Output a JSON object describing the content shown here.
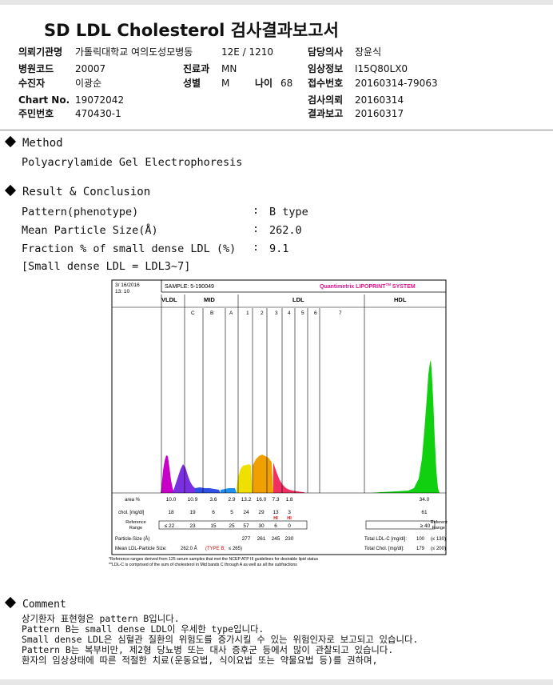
{
  "title": "SD LDL Cholesterol 검사결과보고서",
  "header": {
    "institution_label": "의뢰기관명",
    "institution_value": "가톨릭대학교 여의도성모병동",
    "ward_value": "12E / 1210",
    "doctor_label": "담당의사",
    "doctor_value": "장윤식",
    "hospital_code_label": "병원코드",
    "hospital_code_value": "20007",
    "dept_label": "진료과",
    "dept_value": "MN",
    "clinical_label": "임상정보",
    "clinical_value": "I15Q80LX0",
    "patient_label": "수진자",
    "patient_value": "이광순",
    "sex_label": "성별",
    "sex_value": "M",
    "age_label": "나이",
    "age_value": "68",
    "receipt_label": "접수번호",
    "receipt_value": "20160314-79063",
    "chart_label": "Chart No.",
    "chart_value": "19072042",
    "request_label": "검사의뢰",
    "request_value": "20160314",
    "resident_label": "주민번호",
    "resident_value": "470430-1",
    "report_label": "결과보고",
    "report_value": "20160317"
  },
  "method": {
    "heading": "Method",
    "value": "Polyacrylamide Gel Electrophoresis"
  },
  "result": {
    "heading": "Result & Conclusion",
    "pattern_label": "Pattern(phenotype)",
    "pattern_value": "B type",
    "size_label": "Mean Particle Size(Å)",
    "size_value": "262.0",
    "fraction_label": "Fraction % of small dense LDL (%)",
    "fraction_value": "9.1",
    "note": "[Small dense LDL = LDL3~7]",
    "colon": ":"
  },
  "chart_data": {
    "type": "area",
    "date": "3/ 16/2016",
    "time": "13: 10",
    "sample": "SAMPLE:   5-190049",
    "brand": "Quantimetrix LIPOPRINT",
    "brand_tm": "TM",
    "brand_suffix": " SYSTEM",
    "groups": [
      "VLDL",
      "MID",
      "LDL",
      "HDL"
    ],
    "bands": [
      "C",
      "B",
      "A",
      "1",
      "2",
      "3",
      "4",
      "5",
      "6",
      "7"
    ],
    "rows": {
      "area_label": "area %",
      "area": [
        "10.0",
        "10.9",
        "3.6",
        "2.9",
        "13.2",
        "16.0",
        "7.3",
        "1.8",
        "",
        "34.0"
      ],
      "chol_label": "chol. [mg/dl]",
      "chol": [
        "18",
        "19",
        "6",
        "5",
        "24",
        "29",
        "13",
        "3",
        "",
        "61"
      ],
      "hi_flags": [
        "HI",
        "HI"
      ],
      "ref_label": "Reference\nRange",
      "ref": [
        "≤ 22",
        "23",
        "15",
        "25",
        "57",
        "30",
        "6",
        "0"
      ],
      "ref_hdl": "≥ 40",
      "ref_right": "Reference\nRange",
      "size_label": "Particle-Size (Å)",
      "size": [
        "277",
        "261",
        "245",
        "230"
      ],
      "total_ldl_label": "Total LDL-C [mg/dl]:",
      "total_ldl": "100",
      "total_ldl_ref": "(≤ 130)",
      "total_chol_label": "Total Chol. [mg/dl]:",
      "total_chol": "179",
      "total_chol_ref": "(≤ 200)",
      "mean_size_label": "Mean LDL-Particle Size:",
      "mean_size": "262.0 Å",
      "mean_size_type": "(TYPE B;",
      "mean_size_ref": "≤ 265)"
    },
    "footnote1": "*Reference ranges derived from 125 serum samples that met the NCEP ATP III guidelines for desirable lipid status",
    "footnote2": "**LDL-C is comprised of the sum of cholesterol in Mid bands C through A as well as all the subfractions",
    "colors": {
      "vldl": "#c800c8",
      "mid_c": "#7a30e0",
      "mid_b": "#3048e0",
      "mid_a": "#2090f0",
      "ldl1": "#f0e000",
      "ldl2": "#f0a000",
      "ldl3": "#f03060",
      "hdl": "#10d010",
      "brand": "#e0148c",
      "hi": "#e00000"
    }
  },
  "comment": {
    "heading": "Comment",
    "lines": [
      "상기환자 표현형은 pattern B입니다.",
      "Pattern B는 small dense LDL이 우세한 type입니다.",
      "Small dense LDL은 심혈관 질환의 위험도를 증가시킬 수 있는 위험인자로 보고되고 있습니다.",
      "Pattern B는 복부비만, 제2형 당뇨병 또는 대사 증후군 등에서 많이 관찰되고 있습니다.",
      "환자의 임상상태에 따른 적절한 치료(운동요법, 식이요법 또는 약물요법 등)를 권하며,"
    ]
  }
}
